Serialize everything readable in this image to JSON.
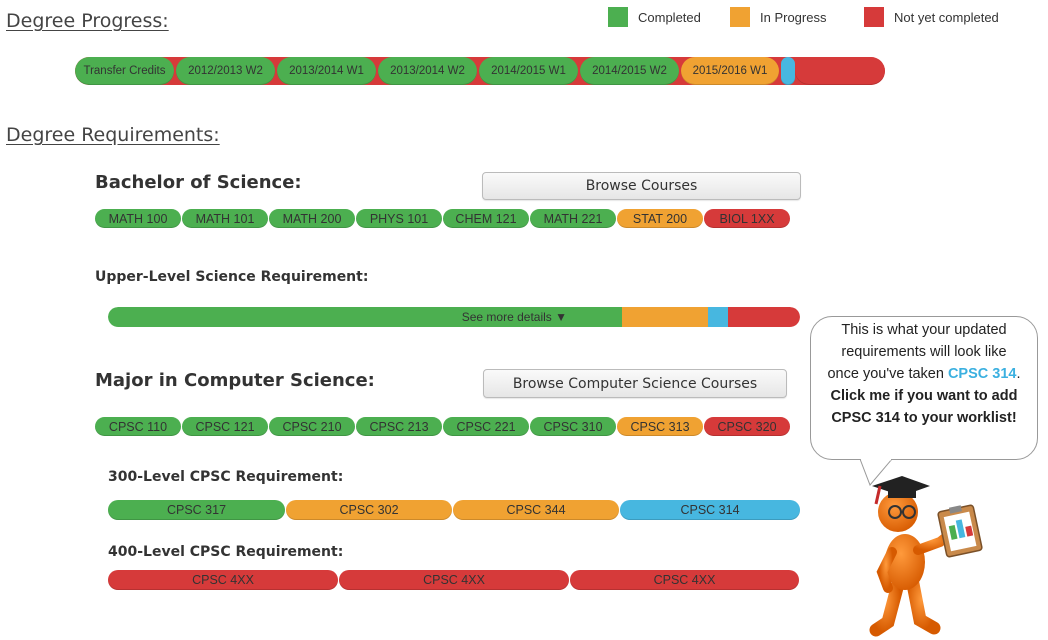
{
  "colors": {
    "completed": "#4caf50",
    "in_progress": "#f0a232",
    "not_completed": "#d63a3a",
    "highlight": "#47b7e0"
  },
  "progress": {
    "title": "Degree Progress:",
    "legend": {
      "completed": "Completed",
      "in_progress": "In Progress",
      "not_completed": "Not yet completed"
    },
    "terms": [
      {
        "label": "Transfer Credits",
        "status": "completed"
      },
      {
        "label": "2012/2013 W2",
        "status": "completed"
      },
      {
        "label": "2013/2014 W1",
        "status": "completed"
      },
      {
        "label": "2013/2014 W2",
        "status": "completed"
      },
      {
        "label": "2014/2015 W1",
        "status": "completed"
      },
      {
        "label": "2014/2015 W2",
        "status": "completed"
      },
      {
        "label": "2015/2016 W1",
        "status": "in_progress"
      }
    ]
  },
  "requirements": {
    "title": "Degree Requirements:",
    "bsc": {
      "heading": "Bachelor of Science:",
      "browse_label": "Browse Courses",
      "courses": [
        {
          "label": "MATH 100",
          "status": "completed"
        },
        {
          "label": "MATH 101",
          "status": "completed"
        },
        {
          "label": "MATH 200",
          "status": "completed"
        },
        {
          "label": "PHYS 101",
          "status": "completed"
        },
        {
          "label": "CHEM 121",
          "status": "completed"
        },
        {
          "label": "MATH 221",
          "status": "completed"
        },
        {
          "label": "STAT 200",
          "status": "in_progress"
        },
        {
          "label": "BIOL 1XX",
          "status": "not_completed"
        }
      ]
    },
    "upper_level": {
      "heading": "Upper-Level Science Requirement:",
      "details_label": "See more details ▼"
    },
    "major": {
      "heading": "Major in Computer Science:",
      "browse_label": "Browse Computer Science Courses",
      "courses": [
        {
          "label": "CPSC 110",
          "status": "completed"
        },
        {
          "label": "CPSC 121",
          "status": "completed"
        },
        {
          "label": "CPSC 210",
          "status": "completed"
        },
        {
          "label": "CPSC 213",
          "status": "completed"
        },
        {
          "label": "CPSC 221",
          "status": "completed"
        },
        {
          "label": "CPSC 310",
          "status": "completed"
        },
        {
          "label": "CPSC 313",
          "status": "in_progress"
        },
        {
          "label": "CPSC 320",
          "status": "not_completed"
        }
      ]
    },
    "cpsc300": {
      "heading": "300-Level CPSC Requirement:",
      "courses": [
        {
          "label": "CPSC 317",
          "status": "completed"
        },
        {
          "label": "CPSC 302",
          "status": "in_progress"
        },
        {
          "label": "CPSC 344",
          "status": "in_progress"
        },
        {
          "label": "CPSC 314",
          "status": "highlight"
        }
      ]
    },
    "cpsc400": {
      "heading": "400-Level CPSC Requirement:",
      "courses": [
        {
          "label": "CPSC 4XX",
          "status": "not_completed"
        },
        {
          "label": "CPSC 4XX",
          "status": "not_completed"
        },
        {
          "label": "CPSC 4XX",
          "status": "not_completed"
        }
      ]
    }
  },
  "callout": {
    "line1": "This is what your updated",
    "line2": "requirements will look like",
    "line3_pre": "once you've taken ",
    "course": "CPSC 314",
    "line3_post": ".",
    "line4": "Click me if you want to add",
    "line5": "CPSC 314 to your worklist!"
  }
}
